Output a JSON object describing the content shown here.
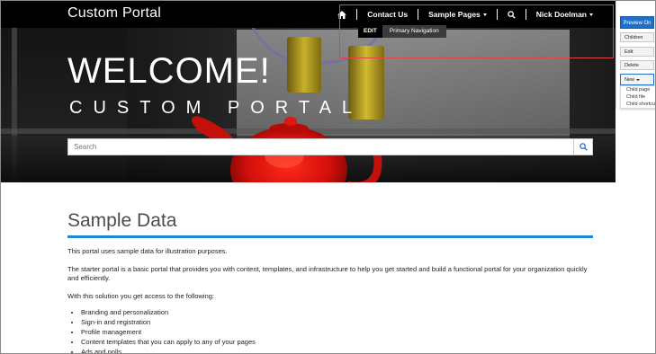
{
  "navbar": {
    "brand": "Custom Portal",
    "items": [
      {
        "label": "Contact Us"
      },
      {
        "label": "Sample Pages"
      },
      {
        "label": "Nick Doelman"
      }
    ],
    "home_icon": "home-icon",
    "search_icon": "search-icon"
  },
  "hero": {
    "title": "WELCOME!",
    "subtitle": "CUSTOM PORTAL",
    "search_placeholder": "Search"
  },
  "edit_bar": {
    "tag": "EDIT",
    "label": "Primary Navigation"
  },
  "admin_panel": {
    "preview": "Preview On",
    "children": "Children",
    "edit": "Edit",
    "delete": "Delete",
    "new": "New",
    "new_menu": [
      "Child page",
      "Child file",
      "Child shortcut"
    ]
  },
  "content": {
    "heading": "Sample Data",
    "paragraphs": [
      "This portal uses sample data for illustration purposes.",
      "The starter portal is a basic portal that provides you with content, templates, and infrastructure to help you get started and build a functional portal for your organization quickly and efficiently.",
      "With this solution you get access to the following:"
    ],
    "bullets": [
      "Branding and personalization",
      "Sign-in and registration",
      "Profile management",
      "Content templates that you can apply to any of your pages",
      "Ads and polls"
    ]
  },
  "colors": {
    "navbar_bg": "#000000",
    "accent_blue": "#1f88d6",
    "highlight_red": "#e0454a",
    "preview_blue": "#1e6fc8"
  }
}
